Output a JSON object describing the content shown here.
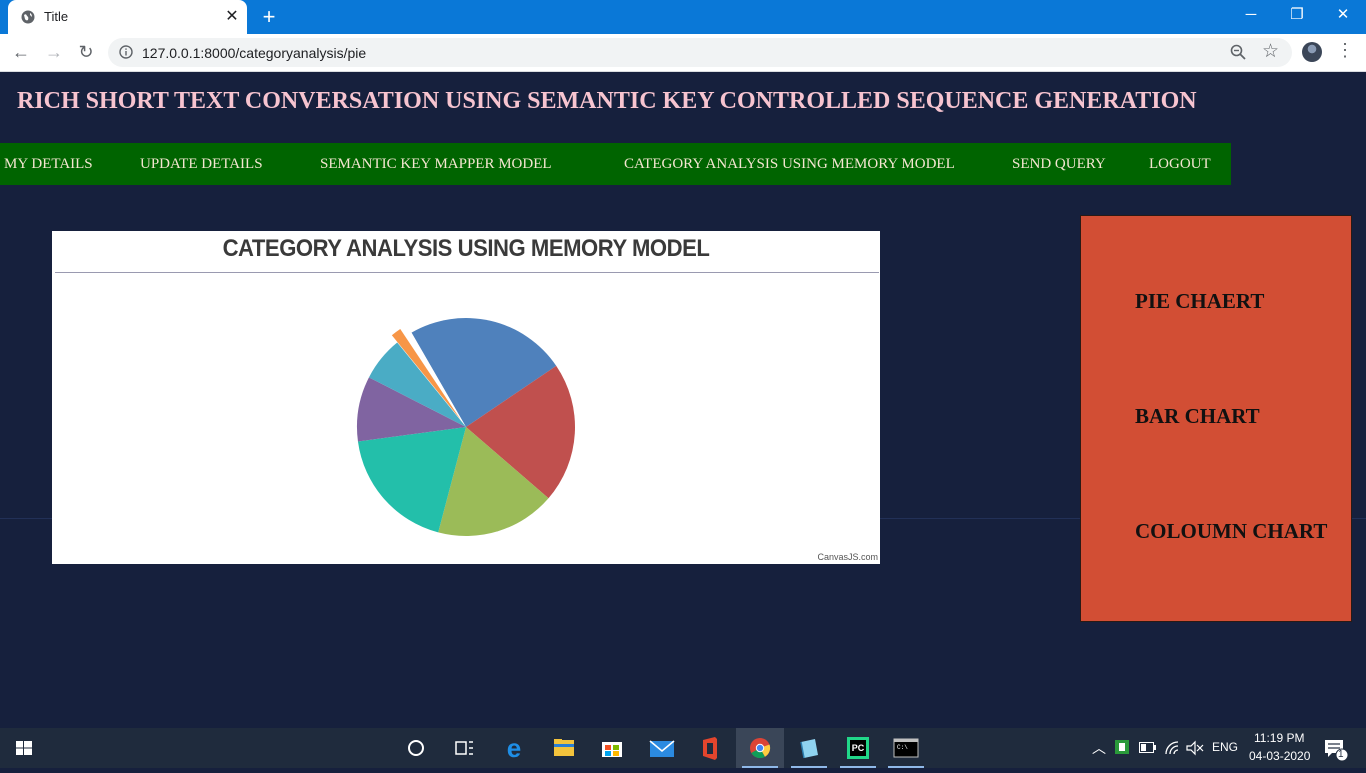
{
  "browser": {
    "tab_title": "Title",
    "url": "127.0.0.1:8000/categoryanalysis/pie"
  },
  "page": {
    "heading": "RICH SHORT TEXT CONVERSATION USING SEMANTIC KEY CONTROLLED SEQUENCE GENERATION",
    "menu": [
      {
        "label": "MY DETAILS"
      },
      {
        "label": "UPDATE DETAILS"
      },
      {
        "label": "SEMANTIC KEY MAPPER MODEL"
      },
      {
        "label": "CATEGORY ANALYSIS USING MEMORY MODEL"
      },
      {
        "label": "SEND QUERY"
      },
      {
        "label": "LOGOUT"
      }
    ],
    "side_links": [
      {
        "label": "PIE CHAERT"
      },
      {
        "label": "BAR CHART"
      },
      {
        "label": "COLOUMN CHART"
      }
    ],
    "chart_credit": "CanvasJS.com"
  },
  "chart_data": {
    "type": "pie",
    "title": "CATEGORY ANALYSIS USING MEMORY MODEL",
    "values": [
      23.5,
      20.5,
      17.5,
      18.5,
      9.5,
      6.5,
      1.5,
      1.0
    ],
    "colors": [
      "#4f81bc",
      "#c0504e",
      "#9bbb58",
      "#23bfaa",
      "#8064a1",
      "#4aacc5",
      "#f79647",
      "#ffffff"
    ],
    "exploded_index": 6
  },
  "taskbar": {
    "language": "ENG",
    "time": "11:19 PM",
    "date": "04-03-2020",
    "notification_count": "1"
  }
}
